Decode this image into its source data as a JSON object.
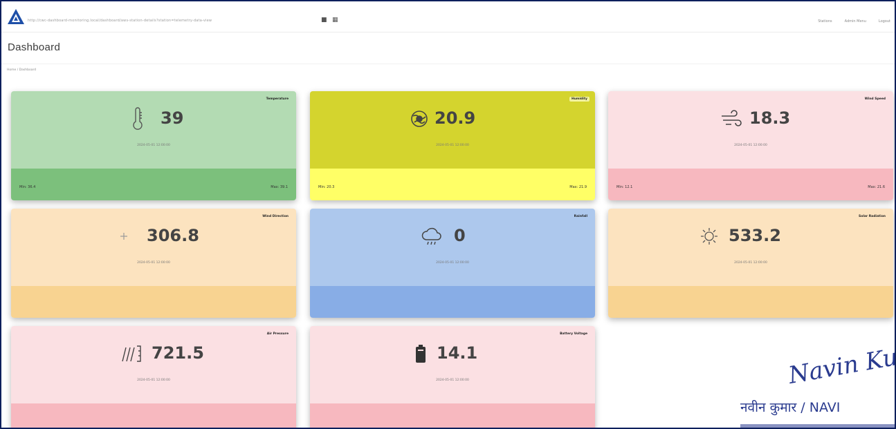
{
  "topbar": {
    "url_text": "http://cwc-dashboard-monitoring.local/dashboard/aws-station-details?station=telemetry-data-view",
    "right_items": [
      "Stations",
      "Admin Menu",
      "Logout"
    ]
  },
  "page": {
    "title": "Dashboard",
    "breadcrumb": "Home / Dashboard"
  },
  "cards": [
    {
      "value": "39",
      "badge": "Temperature",
      "timestamp": "2024-05-01 12:00:00",
      "min": "Min: 36.4",
      "max": "Max: 39.1",
      "icon": "thermometer-icon",
      "top_color": "#b3dbb3",
      "bottom_color": "#7cc07c"
    },
    {
      "value": "20.9",
      "badge": "Humidity",
      "timestamp": "2024-05-01 12:00:00",
      "min": "Min: 20.3",
      "max": "Max: 21.9",
      "icon": "humidity-globe-icon",
      "top_color": "#d4d42e",
      "bottom_color": "#ffff66"
    },
    {
      "value": "18.3",
      "badge": "Wind Speed",
      "timestamp": "2024-05-01 12:00:00",
      "min": "Min: 12.1",
      "max": "Max: 21.6",
      "icon": "wind-icon",
      "top_color": "#fbe0e3",
      "bottom_color": "#f7b8bf"
    },
    {
      "value": "306.8",
      "badge": "Wind Direction",
      "timestamp": "2024-05-01 12:00:00",
      "min": "",
      "max": "",
      "icon": "wind-direction-icon",
      "top_color": "#fce3bf",
      "bottom_color": "#f8d391"
    },
    {
      "value": "0",
      "badge": "Rainfall",
      "timestamp": "2024-05-01 12:00:00",
      "min": "",
      "max": "",
      "icon": "rain-cloud-icon",
      "top_color": "#adc8ed",
      "bottom_color": "#88ade6"
    },
    {
      "value": "533.2",
      "badge": "Solar Radiation",
      "timestamp": "2024-05-01 12:00:00",
      "min": "",
      "max": "",
      "icon": "sun-icon",
      "top_color": "#fce3bf",
      "bottom_color": "#f8d391"
    },
    {
      "value": "721.5",
      "badge": "Air Pressure",
      "timestamp": "2024-05-01 12:00:00",
      "min": "",
      "max": "",
      "icon": "pressure-icon",
      "top_color": "#fbe0e3",
      "bottom_color": "#f7b8bf"
    },
    {
      "value": "14.1",
      "badge": "Battery Voltage",
      "timestamp": "2024-05-01 12:00:00",
      "min": "",
      "max": "",
      "icon": "battery-icon",
      "top_color": "#fbe0e3",
      "bottom_color": "#f7b8bf"
    }
  ],
  "signature": {
    "line1": "Navin Ku",
    "line2": "नवीन कुमार / NAVI"
  }
}
